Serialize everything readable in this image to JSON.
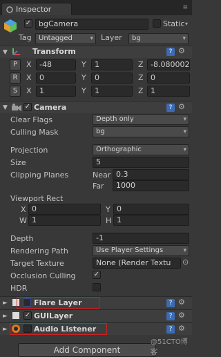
{
  "tab": {
    "title": "Inspector",
    "tools": "≡"
  },
  "object": {
    "name": "bgCamera",
    "static_label": "Static",
    "tag_label": "Tag",
    "tag_value": "Untagged",
    "layer_label": "Layer",
    "layer_value": "bg"
  },
  "transform": {
    "title": "Transform",
    "position": {
      "btn": "P",
      "x": "-48",
      "y": "1",
      "z": "-8.080002"
    },
    "rotation": {
      "btn": "R",
      "x": "0",
      "y": "0",
      "z": "0"
    },
    "scale": {
      "btn": "S",
      "x": "1",
      "y": "1",
      "z": "1"
    }
  },
  "axes": {
    "x": "X",
    "y": "Y",
    "z": "Z",
    "w": "W",
    "h": "H"
  },
  "camera": {
    "title": "Camera",
    "clear_flags_label": "Clear Flags",
    "clear_flags": "Depth only",
    "culling_mask_label": "Culling Mask",
    "culling_mask": "bg",
    "projection_label": "Projection",
    "projection": "Orthographic",
    "size_label": "Size",
    "size": "5",
    "clipping_label": "Clipping Planes",
    "near_label": "Near",
    "near": "0.3",
    "far_label": "Far",
    "far": "1000",
    "viewport_label": "Viewport Rect",
    "vp_x": "0",
    "vp_y": "0",
    "vp_w": "1",
    "vp_h": "1",
    "depth_label": "Depth",
    "depth": "-1",
    "rendering_path_label": "Rendering Path",
    "rendering_path": "Use Player Settings",
    "target_texture_label": "Target Texture",
    "target_texture": "None (Render Textu",
    "occlusion_label": "Occlusion Culling",
    "occlusion_check": "✓",
    "hdr_label": "HDR"
  },
  "components": {
    "flare": "Flare Layer",
    "gui": "GUILayer",
    "audio": "Audio Listener",
    "check_mark": "✓",
    "help": "?",
    "gear": "⚙"
  },
  "add_component": "Add Component",
  "watermark": "@51CTO博客",
  "colors": {
    "background": "#383838",
    "highlight": "#d02020",
    "help": "#3b6bb5"
  }
}
